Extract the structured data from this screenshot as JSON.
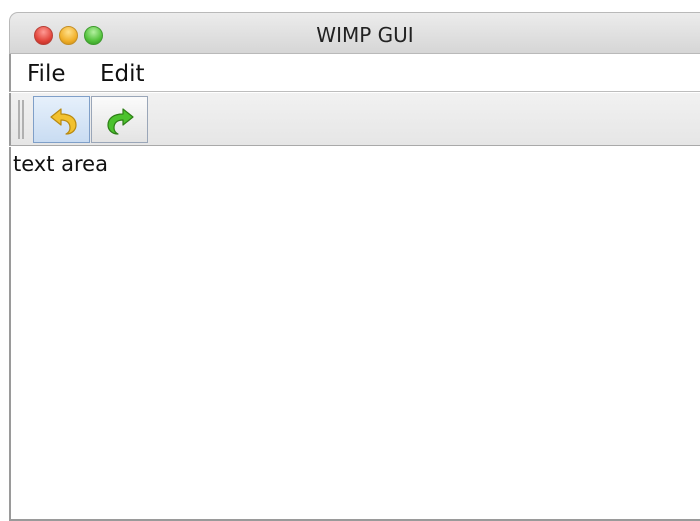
{
  "window": {
    "title": "WIMP GUI"
  },
  "menubar": {
    "items": [
      {
        "label": "File"
      },
      {
        "label": "Edit"
      }
    ]
  },
  "toolbar": {
    "buttons": [
      {
        "icon": "undo-arrow-icon",
        "color": "#f2c12e"
      },
      {
        "icon": "redo-arrow-icon",
        "color": "#4cc22e"
      }
    ]
  },
  "editor": {
    "text": "text area"
  }
}
